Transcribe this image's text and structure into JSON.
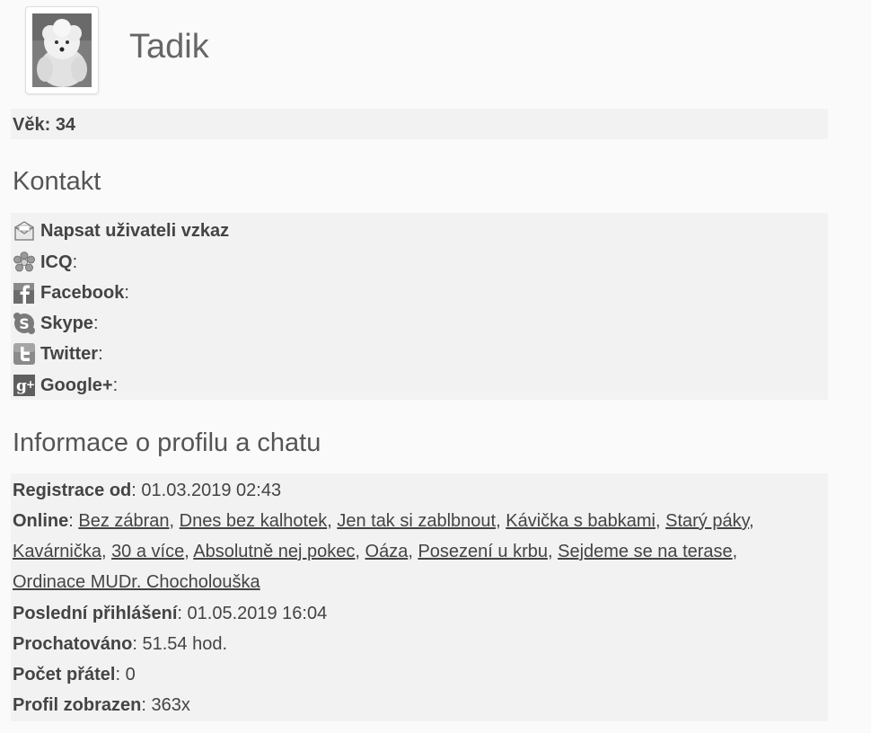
{
  "profile": {
    "username": "Tadik",
    "avatar_alt": "white poodle avatar",
    "age_label": "Věk:",
    "age_value": "34"
  },
  "contact": {
    "title": "Kontakt",
    "items": [
      {
        "icon": "envelope-icon",
        "label": "Napsat uživateli vzkaz",
        "suffix": ""
      },
      {
        "icon": "icq-flower-icon",
        "label": "ICQ",
        "suffix": ":"
      },
      {
        "icon": "facebook-icon",
        "label": "Facebook",
        "suffix": ":"
      },
      {
        "icon": "skype-icon",
        "label": "Skype",
        "suffix": ":"
      },
      {
        "icon": "twitter-icon",
        "label": "Twitter",
        "suffix": ":"
      },
      {
        "icon": "google-plus-icon",
        "label": "Google+",
        "suffix": ":"
      }
    ]
  },
  "info": {
    "title": "Informace o profilu a chatu",
    "registration_label": "Registrace od",
    "registration_value": "01.03.2019 02:43",
    "online_label": "Online",
    "online_rooms": [
      "Bez zábran",
      "Dnes bez kalhotek",
      "Jen tak si zablbnout",
      "Kávička s babkami",
      "Starý páky",
      "Kavárnička",
      "30 a více",
      "Absolutně nej pokec",
      "Oáza",
      "Posezení u krbu",
      "Sejdeme se na terase",
      "Ordinace MUDr. Chocholouška"
    ],
    "last_login_label": "Poslední přihlášení",
    "last_login_value": "01.05.2019 16:04",
    "chatted_label": "Prochatováno",
    "chatted_value": "51.54 hod.",
    "friends_label": "Počet přátel",
    "friends_value": "0",
    "views_label": "Profil zobrazen",
    "views_value": "363x"
  },
  "colors": {
    "background": "#fafafa",
    "panel": "#f2f2f2",
    "text": "#444444",
    "title": "#555555"
  }
}
